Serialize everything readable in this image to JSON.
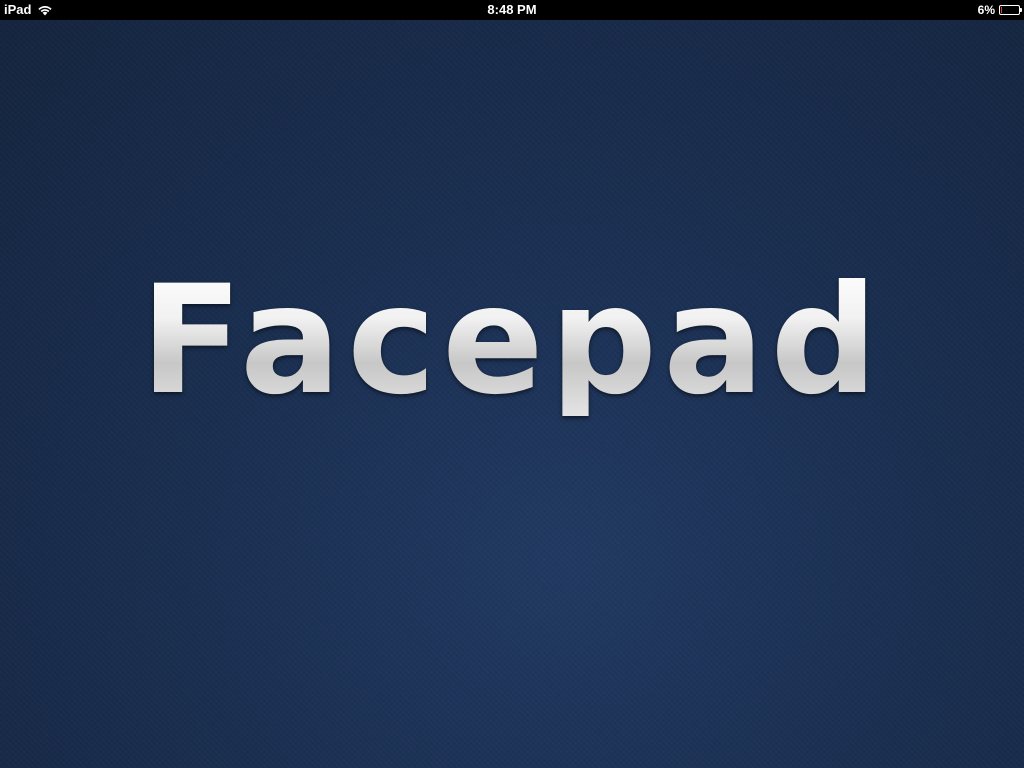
{
  "status_bar": {
    "device_label": "iPad",
    "time": "8:48 PM",
    "battery_percent_label": "6%",
    "battery_level": 0.06,
    "icons": [
      "wifi-icon",
      "battery-icon"
    ]
  },
  "splash": {
    "app_title": "Facepad"
  },
  "colors": {
    "background_dark": "#15253f",
    "background_mid": "#1b3053",
    "battery_low": "#e23b2e",
    "logo_silver": "#e6e6e6"
  }
}
